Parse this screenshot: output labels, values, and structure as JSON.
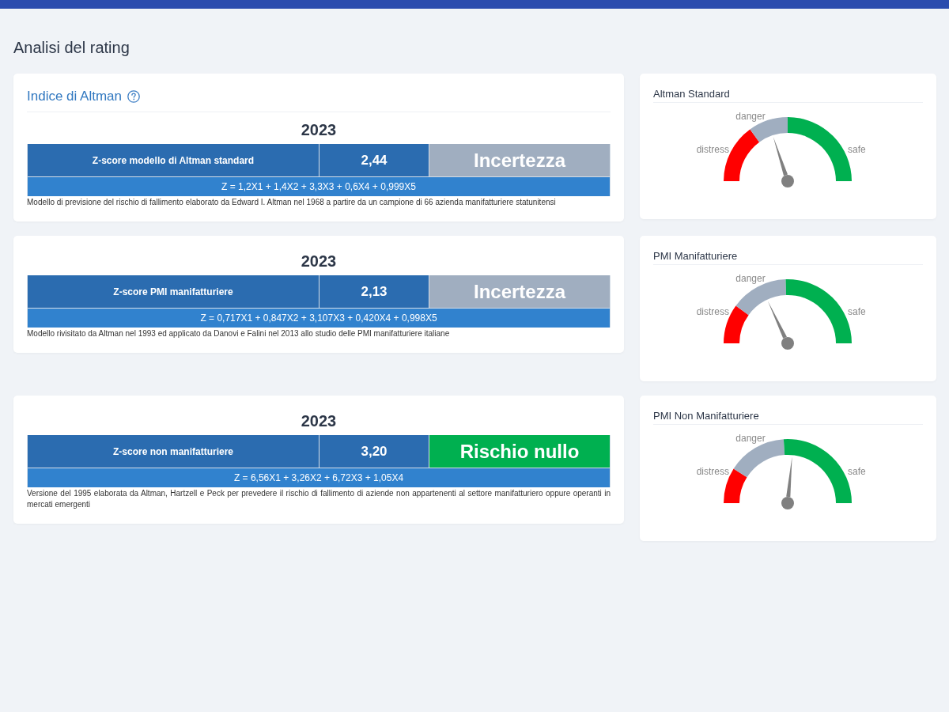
{
  "page": {
    "title": "Analisi del rating"
  },
  "altman": {
    "title": "Indice di Altman",
    "models": [
      {
        "year": "2023",
        "label": "Z-score modello di Altman standard",
        "score": "2,44",
        "status": {
          "text": "Incertezza",
          "color": "#a0aec0"
        },
        "formula": "Z = 1,2X1 + 1,4X2 + 3,3X3 + 0,6X4 + 0,999X5",
        "description": "Modello di previsione del rischio di fallimento elaborato da Edward I. Altman nel 1968 a partire da un campione di 66 azienda manifatturiere statunitensi"
      },
      {
        "year": "2023",
        "label": "Z-score PMI manifatturiere",
        "score": "2,13",
        "status": {
          "text": "Incertezza",
          "color": "#a0aec0"
        },
        "formula": "Z = 0,717X1 + 0,847X2 + 3,107X3 + 0,420X4 + 0,998X5",
        "description": "Modello rivisitato da Altman nel 1993 ed applicato da Danovi e Falini nel 2013 allo studio delle PMI manifatturiere italiane"
      },
      {
        "year": "2023",
        "label": "Z-score non manifatturiere",
        "score": "3,20",
        "status": {
          "text": "Rischio nullo",
          "color": "#00b050"
        },
        "formula": "Z = 6,56X1 + 3,26X2 + 6,72X3 + 1,05X4",
        "description": "Versione del 1995 elaborata da Altman, Hartzell e Peck per prevedere il rischio di fallimento di aziende non appartenenti al settore manifatturiero oppure operanti in mercati emergenti"
      }
    ]
  },
  "gauges": [
    {
      "title": "Altman Standard",
      "level": 0.4,
      "chart_data": {
        "type": "donut",
        "categories": [
          "distress",
          "danger",
          "safe"
        ],
        "values": [
          30,
          20,
          50
        ],
        "needle": "danger"
      }
    },
    {
      "title": "PMI Manifatturiere",
      "level": 0.36,
      "chart_data": {
        "type": "donut",
        "categories": [
          "distress",
          "danger",
          "safe"
        ],
        "values": [
          20,
          29,
          51
        ],
        "needle": "danger"
      }
    },
    {
      "title": "PMI Non Manifatturiere",
      "level": 0.53,
      "chart_data": {
        "type": "donut",
        "categories": [
          "distress",
          "danger",
          "safe"
        ],
        "values": [
          18,
          30,
          52
        ],
        "needle": "safe"
      }
    }
  ]
}
